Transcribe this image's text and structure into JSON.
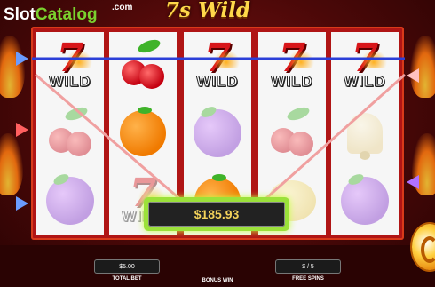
{
  "brand": {
    "slot": "Slot",
    "catalog": "Catalog",
    "dotcom": ".com"
  },
  "game": {
    "title": "7s Wild"
  },
  "reels": [
    [
      {
        "symbol": "seven-wild",
        "label": "WILD",
        "dim": false
      },
      {
        "symbol": "cherry",
        "dim": true
      },
      {
        "symbol": "plum",
        "dim": true
      }
    ],
    [
      {
        "symbol": "cherry",
        "dim": false
      },
      {
        "symbol": "orange",
        "dim": false
      },
      {
        "symbol": "seven-wild",
        "label": "WILD",
        "dim": true
      }
    ],
    [
      {
        "symbol": "seven-wild",
        "label": "WILD",
        "dim": false
      },
      {
        "symbol": "plum",
        "dim": true
      },
      {
        "symbol": "orange",
        "dim": false
      }
    ],
    [
      {
        "symbol": "seven-wild",
        "label": "WILD",
        "dim": false
      },
      {
        "symbol": "cherry",
        "dim": true
      },
      {
        "symbol": "lemon",
        "dim": true
      }
    ],
    [
      {
        "symbol": "seven-wild",
        "label": "WILD",
        "dim": false
      },
      {
        "symbol": "bell",
        "dim": true
      },
      {
        "symbol": "plum",
        "dim": true
      }
    ]
  ],
  "win": {
    "amount": "$185.93"
  },
  "footer": {
    "total_bet_value": "$5.00",
    "total_bet_label": "TOTAL BET",
    "bonus_win_label": "BONUS WIN",
    "free_spins_value": "$ / 5",
    "free_spins_label": "FREE SPINS"
  },
  "colors": {
    "payline_blue": "#2b3fd8",
    "payline_pink": "#f0a0a0",
    "arrow_left_blue": "#6a9cff",
    "arrow_left_red": "#ff6060",
    "arrow_right_pink": "#ffc0c0",
    "arrow_right_purple": "#b070ff",
    "win_glow": "#9be13a"
  },
  "icons": {
    "spin": "spin-button-icon"
  }
}
